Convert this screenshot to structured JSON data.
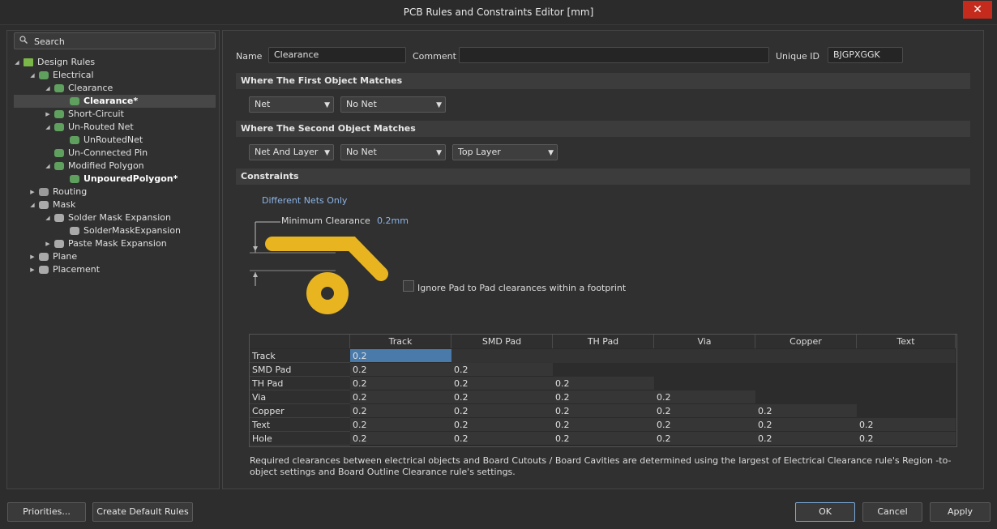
{
  "window": {
    "title": "PCB Rules and Constraints Editor [mm]"
  },
  "search": {
    "label": "Search"
  },
  "tree": [
    {
      "label": "Design Rules",
      "level": 0,
      "toggle": "◢",
      "bold": false,
      "selected": false,
      "icon": "design-rules-icon"
    },
    {
      "label": "Electrical",
      "level": 1,
      "toggle": "◢",
      "bold": false,
      "selected": false,
      "icon": "electrical-icon"
    },
    {
      "label": "Clearance",
      "level": 2,
      "toggle": "◢",
      "bold": false,
      "selected": false,
      "icon": "clearance-icon"
    },
    {
      "label": "Clearance*",
      "level": 3,
      "toggle": "",
      "bold": true,
      "selected": true,
      "icon": "clearance-rule-icon"
    },
    {
      "label": "Short-Circuit",
      "level": 2,
      "toggle": "▶",
      "bold": false,
      "selected": false,
      "icon": "short-circuit-icon"
    },
    {
      "label": "Un-Routed Net",
      "level": 2,
      "toggle": "◢",
      "bold": false,
      "selected": false,
      "icon": "unrouted-net-icon"
    },
    {
      "label": "UnRoutedNet",
      "level": 3,
      "toggle": "",
      "bold": false,
      "selected": false,
      "icon": "unrouted-net-rule-icon"
    },
    {
      "label": "Un-Connected Pin",
      "level": 2,
      "toggle": "",
      "bold": false,
      "selected": false,
      "icon": "unconnected-pin-icon"
    },
    {
      "label": "Modified Polygon",
      "level": 2,
      "toggle": "◢",
      "bold": false,
      "selected": false,
      "icon": "modified-polygon-icon"
    },
    {
      "label": "UnpouredPolygon*",
      "level": 3,
      "toggle": "",
      "bold": true,
      "selected": false,
      "icon": "unpoured-polygon-icon"
    },
    {
      "label": "Routing",
      "level": 1,
      "toggle": "▶",
      "bold": false,
      "selected": false,
      "icon": "routing-icon"
    },
    {
      "label": "Mask",
      "level": 1,
      "toggle": "◢",
      "bold": false,
      "selected": false,
      "icon": "mask-icon"
    },
    {
      "label": "Solder Mask Expansion",
      "level": 2,
      "toggle": "◢",
      "bold": false,
      "selected": false,
      "icon": "solder-mask-icon"
    },
    {
      "label": "SolderMaskExpansion",
      "level": 3,
      "toggle": "",
      "bold": false,
      "selected": false,
      "icon": "solder-mask-rule-icon"
    },
    {
      "label": "Paste Mask Expansion",
      "level": 2,
      "toggle": "▶",
      "bold": false,
      "selected": false,
      "icon": "paste-mask-icon"
    },
    {
      "label": "Plane",
      "level": 1,
      "toggle": "▶",
      "bold": false,
      "selected": false,
      "icon": "plane-icon"
    },
    {
      "label": "Placement",
      "level": 1,
      "toggle": "▶",
      "bold": false,
      "selected": false,
      "icon": "placement-icon"
    }
  ],
  "rule": {
    "name_label": "Name",
    "name_value": "Clearance",
    "comment_label": "Comment",
    "comment_value": "",
    "uid_label": "Unique ID",
    "uid_value": "BJGPXGGK"
  },
  "first_match": {
    "heading": "Where The First Object Matches",
    "type": "Net",
    "value": "No Net"
  },
  "second_match": {
    "heading": "Where The Second Object Matches",
    "type": "Net And Layer",
    "value": "No Net",
    "layer": "Top Layer"
  },
  "constraints": {
    "heading": "Constraints",
    "net_scope": "Different Nets Only",
    "min_clearance_label": "Minimum Clearance",
    "min_clearance_value": "0.2mm",
    "ignore_pad_label": "Ignore Pad to Pad clearances within a footprint",
    "ignore_pad_checked": false
  },
  "matrix": {
    "columns": [
      "Track",
      "SMD Pad",
      "TH Pad",
      "Via",
      "Copper",
      "Text"
    ],
    "rows": [
      {
        "name": "Track",
        "cells": [
          "0.2"
        ]
      },
      {
        "name": "SMD Pad",
        "cells": [
          "0.2",
          "0.2"
        ]
      },
      {
        "name": "TH Pad",
        "cells": [
          "0.2",
          "0.2",
          "0.2"
        ]
      },
      {
        "name": "Via",
        "cells": [
          "0.2",
          "0.2",
          "0.2",
          "0.2"
        ]
      },
      {
        "name": "Copper",
        "cells": [
          "0.2",
          "0.2",
          "0.2",
          "0.2",
          "0.2"
        ]
      },
      {
        "name": "Text",
        "cells": [
          "0.2",
          "0.2",
          "0.2",
          "0.2",
          "0.2",
          "0.2"
        ]
      },
      {
        "name": "Hole",
        "cells": [
          "0.2",
          "0.2",
          "0.2",
          "0.2",
          "0.2",
          "0.2"
        ]
      }
    ]
  },
  "note": "Required clearances between electrical objects and Board Cutouts / Board Cavities are determined using the largest of Electrical Clearance rule's Region -to- object settings and Board Outline Clearance rule's settings.",
  "buttons": {
    "priorities": "Priorities...",
    "create_default": "Create Default Rules",
    "ok": "OK",
    "cancel": "Cancel",
    "apply": "Apply"
  },
  "colors": {
    "accent": "#e8b520",
    "selected_cell": "#4a7aaa",
    "link": "#8cb4e6",
    "close": "#c42b1c"
  }
}
